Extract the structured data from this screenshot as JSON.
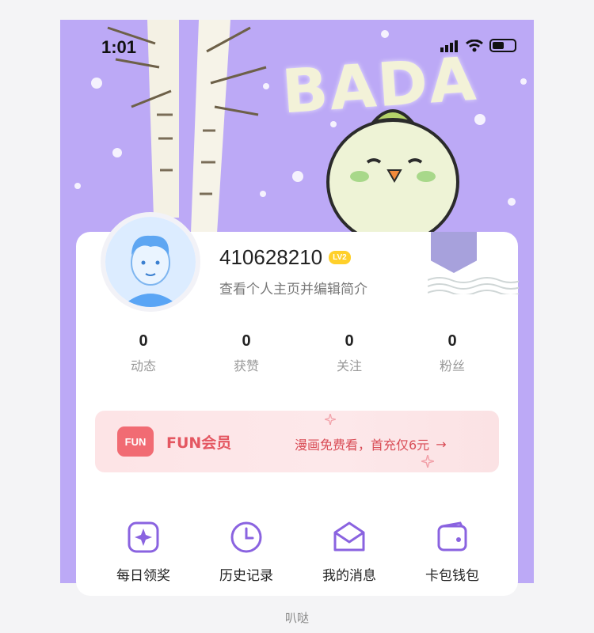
{
  "status_bar": {
    "time": "1:01"
  },
  "banner": {
    "text": "BADA"
  },
  "profile": {
    "username": "410628210",
    "level_badge": "LV2",
    "subtitle": "查看个人主页并编辑简介"
  },
  "stats": [
    {
      "value": "0",
      "label": "动态"
    },
    {
      "value": "0",
      "label": "获赞"
    },
    {
      "value": "0",
      "label": "关注"
    },
    {
      "value": "0",
      "label": "粉丝"
    }
  ],
  "vip": {
    "icon_text": "FUN",
    "title": "FUN会员",
    "promo": "漫画免费看，首充仅6元",
    "arrow": "→"
  },
  "menu": [
    {
      "label": "每日领奖",
      "icon": "sparkle-icon"
    },
    {
      "label": "历史记录",
      "icon": "clock-icon"
    },
    {
      "label": "我的消息",
      "icon": "envelope-icon"
    },
    {
      "label": "卡包钱包",
      "icon": "wallet-icon"
    }
  ],
  "footer": {
    "caption": "叭哒"
  },
  "colors": {
    "banner_bg": "#bca9f6",
    "accent": "#8a63e0",
    "vip_red": "#e45761",
    "badge_yellow": "#ffd02a"
  }
}
